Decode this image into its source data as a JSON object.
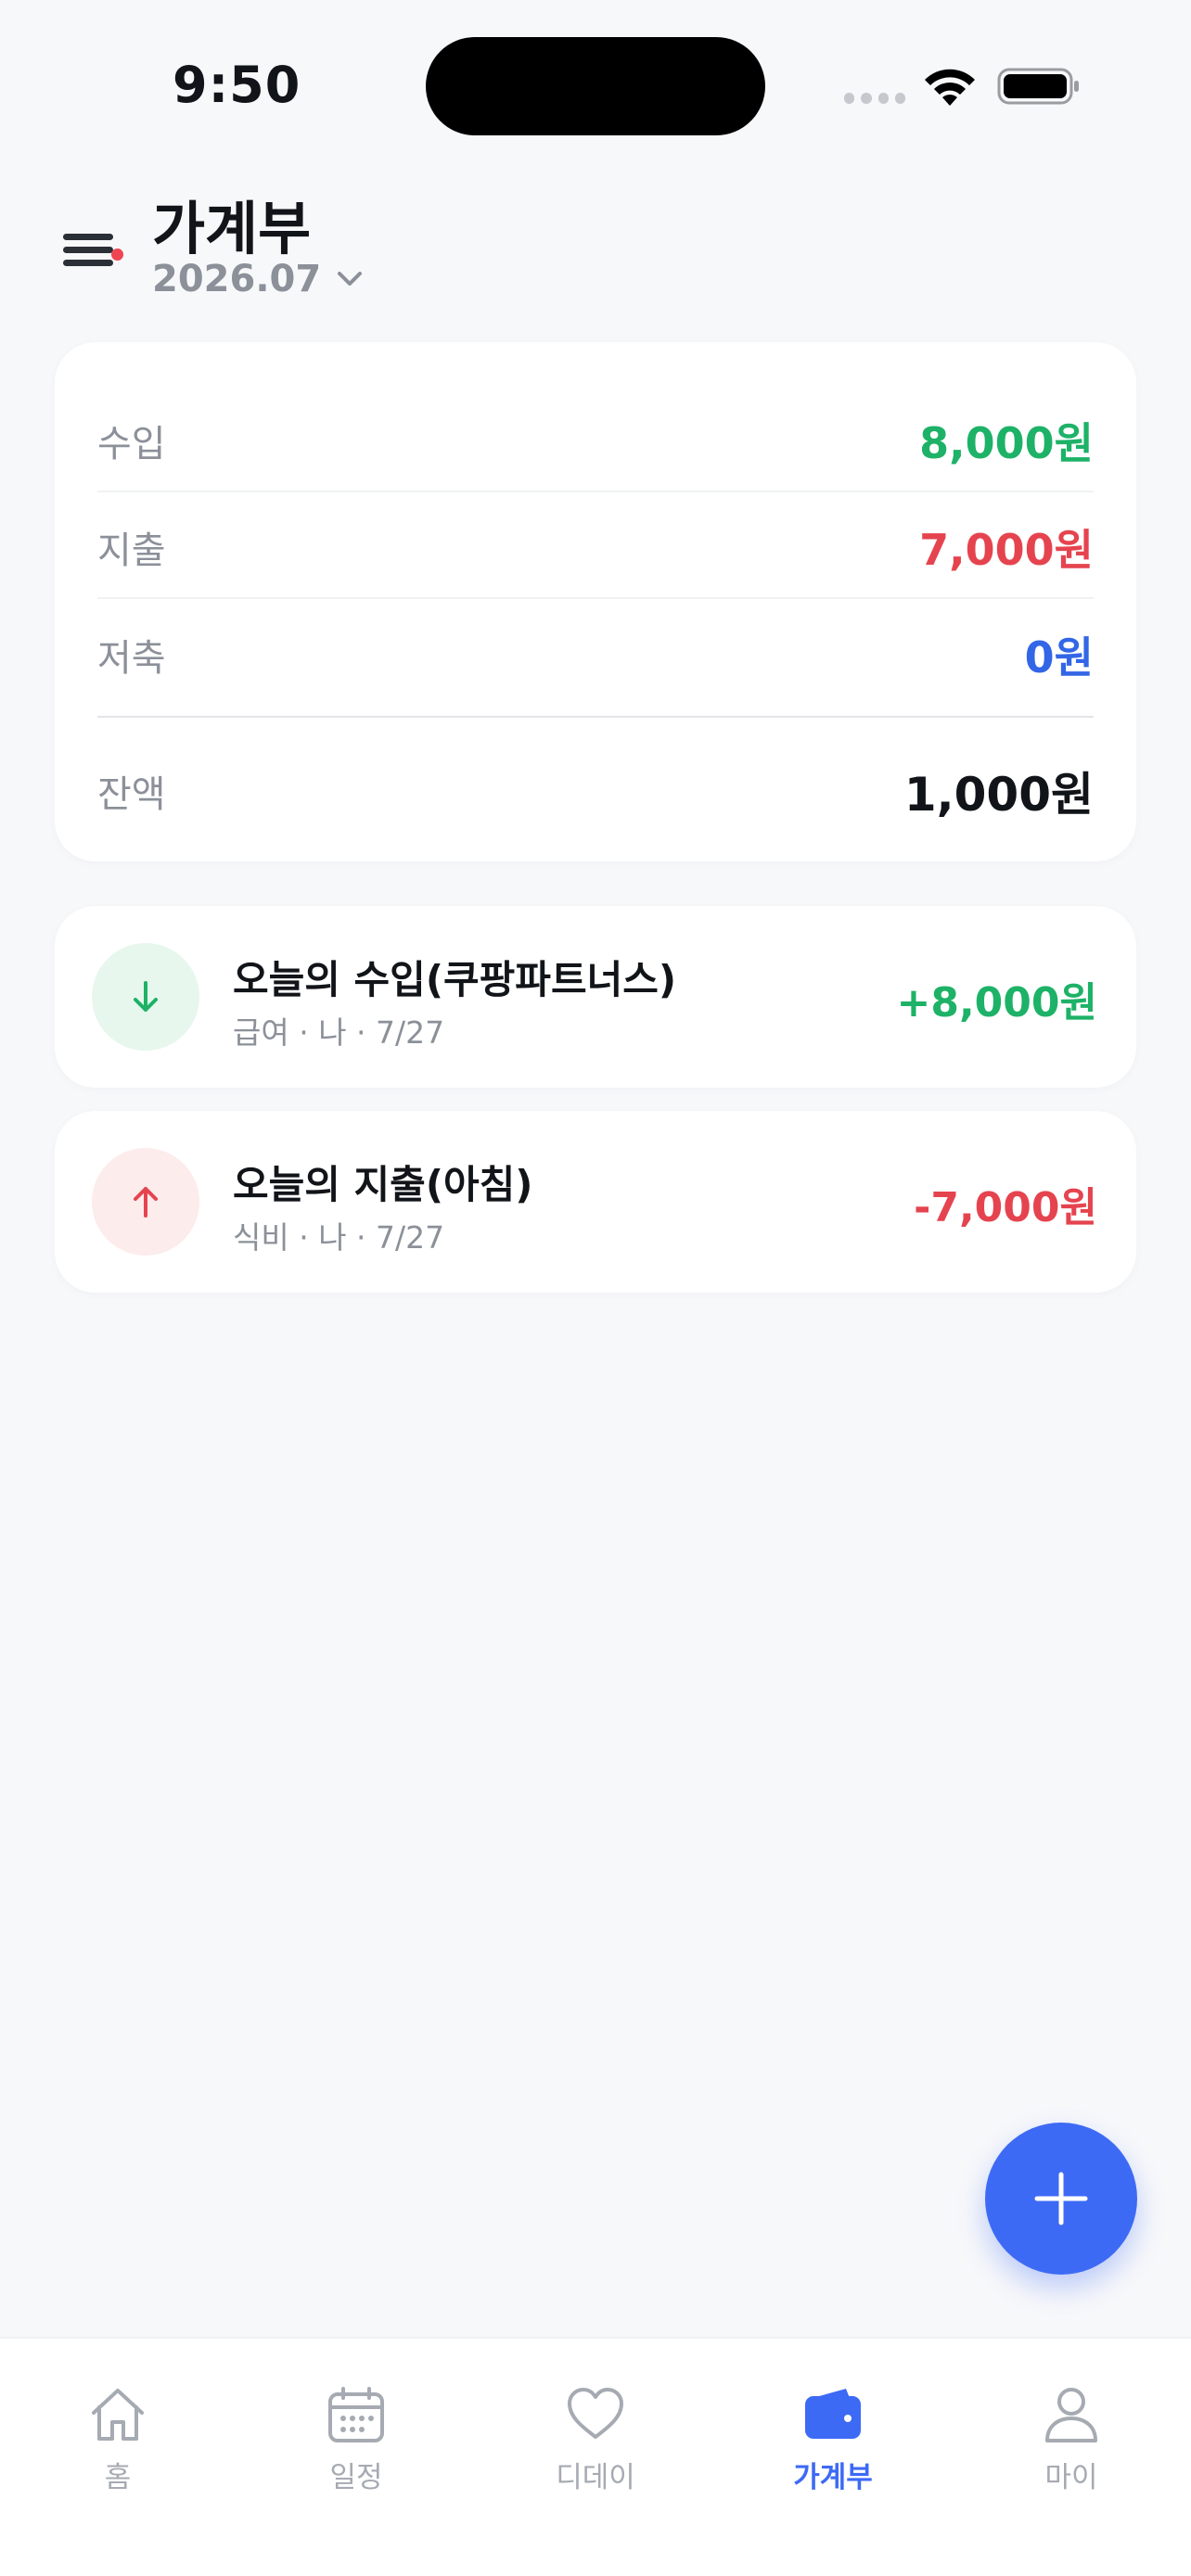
{
  "status_bar": {
    "time": "9:50"
  },
  "header": {
    "title": "가계부",
    "month": "2026.07"
  },
  "summary": {
    "rows": [
      {
        "label": "수입",
        "value": "8,000원",
        "color": "#1db267"
      },
      {
        "label": "지출",
        "value": "7,000원",
        "color": "#e5444f"
      },
      {
        "label": "저축",
        "value": "0원",
        "color": "#3366e6"
      }
    ],
    "balance": {
      "label": "잔액",
      "value": "1,000원",
      "color": "#111418"
    }
  },
  "transactions": [
    {
      "title": "오늘의 수입(쿠팡파트너스)",
      "meta": "급여 · 나 · 7/27",
      "amount": "+8,000원",
      "type": "income",
      "icon": "arrow-down-icon",
      "color": "#1db267",
      "icon_bg": "#e7f7ee"
    },
    {
      "title": "오늘의 지출(아침)",
      "meta": "식비 · 나 · 7/27",
      "amount": "-7,000원",
      "type": "expense",
      "icon": "arrow-up-icon",
      "color": "#e5444f",
      "icon_bg": "#fdecec"
    }
  ],
  "fab": {
    "icon": "plus-icon",
    "color": "#3d6af5"
  },
  "tab_bar": {
    "active": "가계부",
    "active_color": "#3d6af5",
    "items": [
      {
        "label": "홈",
        "icon": "home-icon"
      },
      {
        "label": "일정",
        "icon": "calendar-icon"
      },
      {
        "label": "디데이",
        "icon": "heart-icon"
      },
      {
        "label": "가계부",
        "icon": "wallet-icon"
      },
      {
        "label": "마이",
        "icon": "person-icon"
      }
    ]
  }
}
